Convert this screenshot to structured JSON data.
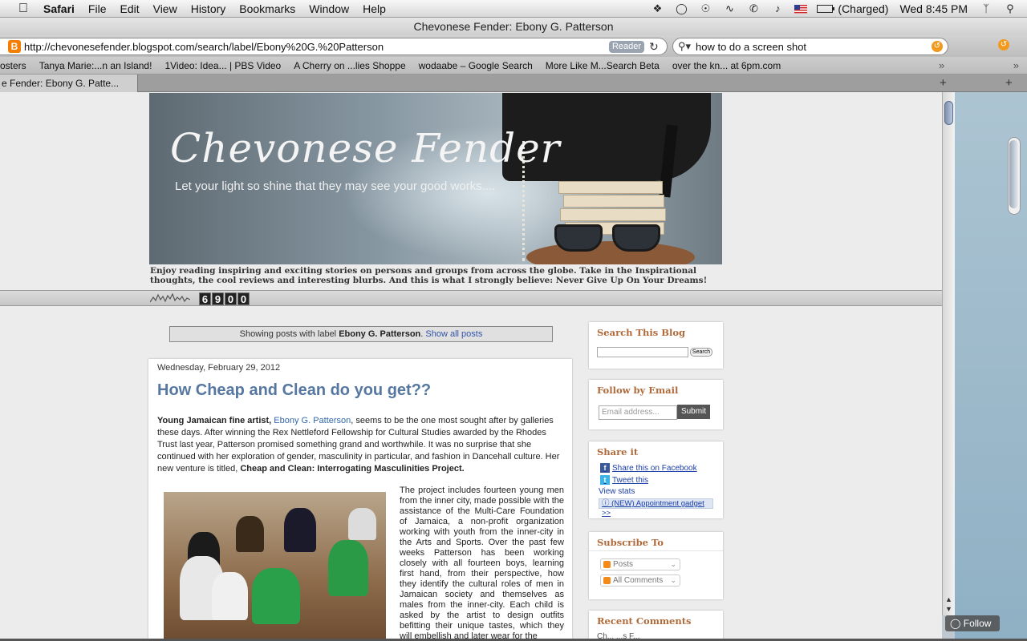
{
  "menubar": {
    "app": "Safari",
    "items": [
      "File",
      "Edit",
      "View",
      "History",
      "Bookmarks",
      "Window",
      "Help"
    ],
    "battery_text": "(Charged)",
    "clock": "Wed 8:45 PM"
  },
  "window": {
    "title": "Chevonese Fender: Ebony G. Patterson"
  },
  "toolbar": {
    "url": "http://chevonesefender.blogspot.com/search/label/Ebony%20G.%20Patterson",
    "reader_label": "Reader",
    "search_value": "how to do a screen shot"
  },
  "bookmarks": [
    "osters",
    "Tanya Marie:...n an Island!",
    "1Video: Idea... | PBS Video",
    "A Cherry on ...lies Shoppe",
    "wodaabe – Google Search",
    "More Like M...Search Beta",
    "over the kn... at 6pm.com"
  ],
  "tab": {
    "title": "e Fender: Ebony G. Patte..."
  },
  "blog": {
    "header_title": "Chevonese Fender",
    "header_subtitle": "Let your light so shine that they may see your good works....",
    "description": "Enjoy reading inspiring and exciting stories on persons and groups from across the globe. Take in the Inspirational thoughts, the cool reviews and interesting blurbs. And this is what I strongly believe: Never Give Up On Your Dreams!",
    "counter": [
      "6",
      "9",
      "0",
      "0"
    ]
  },
  "label_bar": {
    "prefix": "Showing posts with label ",
    "label": "Ebony G. Patterson",
    "suffix": ". ",
    "show_all": "Show all posts"
  },
  "post": {
    "date": "Wednesday, February 29, 2012",
    "title": "How Cheap and Clean do you get??",
    "intro_lead": "Young Jamaican fine artist, ",
    "intro_link": "Ebony G. Patterson",
    "intro_rest": ", seems to be the one most sought after by galleries these days.  After winning the Rex Nettleford Fellowship for Cultural Studies awarded by the Rhodes Trust last year, Patterson promised something grand and worthwhile.  It was no surprise that she continued with her exploration of gender, masculinity in particular, and fashion in Dancehall culture.  Her new venture is titled, ",
    "intro_bold": "Cheap and Clean: Interrogating Masculinities Project.",
    "col2": "The project includes fourteen young men from the inner city, made possible with the assistance of the Multi-Care Foundation of Jamaica, a non-profit organization working with youth from the inner-city in the Arts and Sports. Over the past few weeks Patterson has been working closely with all fourteen boys, learning first hand, from their perspective, how they identify the cultural roles of men in Jamaican society and themselves as males from the inner-city. Each child is asked by the artist to design outfits befitting their unique tastes, which they will embellish and later wear for the"
  },
  "sidebar": {
    "search_title": "Search This Blog",
    "search_button": "Search",
    "follow_title": "Follow by Email",
    "email_placeholder": "Email address...",
    "submit_label": "Submit",
    "share_title": "Share it",
    "share_facebook": "Share this on Facebook",
    "share_tweet": "Tweet this",
    "view_stats": "View stats",
    "appointment": "(NEW) Appointment gadget >>",
    "subscribe_title": "Subscribe To",
    "sub_posts": "Posts",
    "sub_comments": "All Comments",
    "recent_title": "Recent Comments",
    "recent_first": "Ch... ...s F..."
  },
  "follow_button": "Follow",
  "colors": {
    "post_title": "#5577a0",
    "widget_title": "#b06a3a",
    "link": "#1a3da8"
  }
}
